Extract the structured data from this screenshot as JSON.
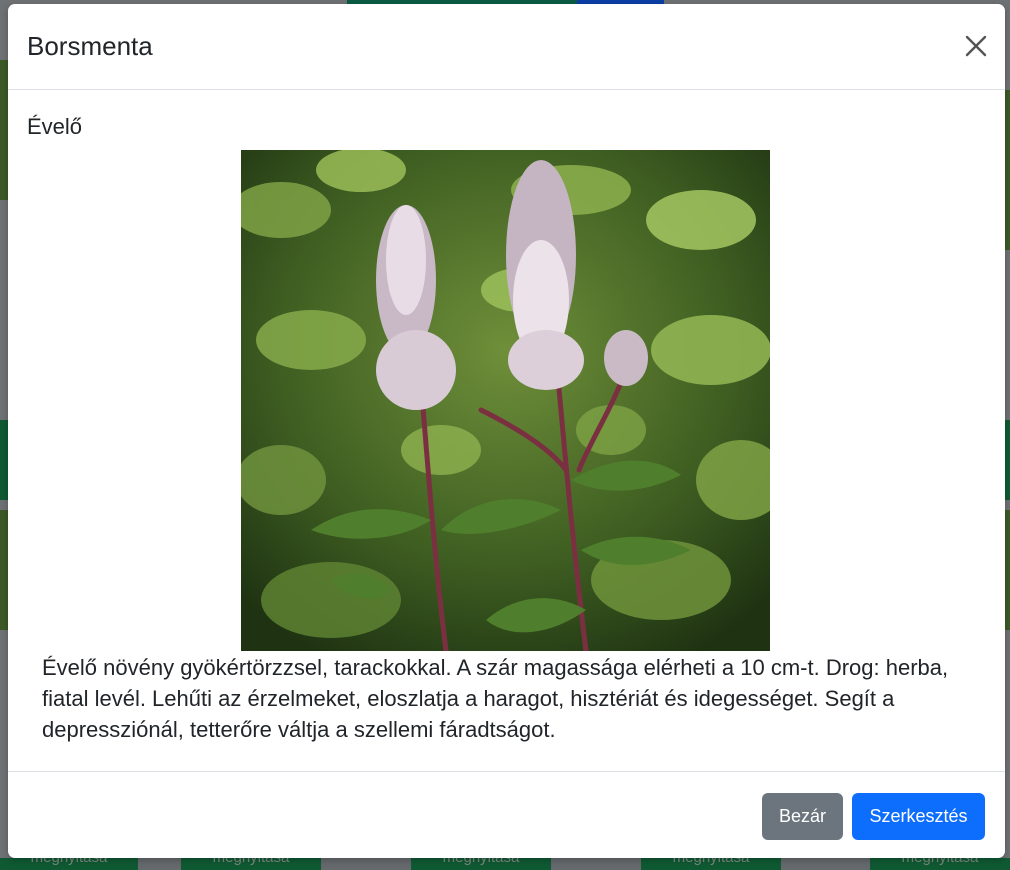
{
  "background": {
    "card_button_label": "megnyitása"
  },
  "modal": {
    "title": "Borsmenta",
    "close_icon": "close-icon",
    "subtitle": "Évelő",
    "image_alt": "Borsmenta",
    "description": "Évelő növény gyökértörzzsel, tarackokkal. A szár magassága elérheti a 10 cm-t. Drog: herba, fiatal levél. Lehűti az érzelmeket, eloszlatja a haragot, hisztériát és idegességet. Segít a depressziónál, tetterőre váltja a szellemi fáradtságot.",
    "footer": {
      "close_label": "Bezár",
      "edit_label": "Szerkesztés"
    }
  },
  "colors": {
    "primary": "#0d6efd",
    "secondary": "#6c757d"
  }
}
